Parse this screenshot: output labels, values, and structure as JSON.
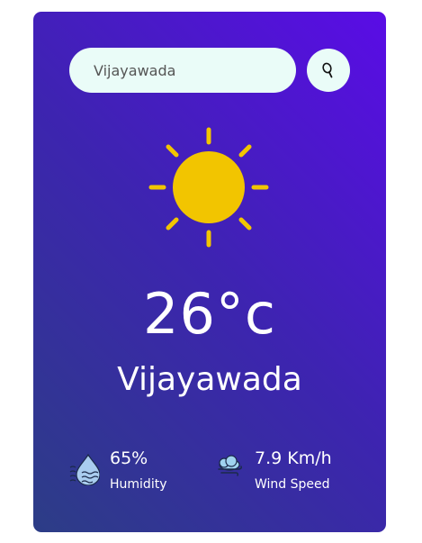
{
  "search": {
    "value": "Vijayawada",
    "icon": "search-icon"
  },
  "weather": {
    "icon": "sun-icon",
    "temperature": "26°c",
    "city": "Vijayawada"
  },
  "humidity": {
    "icon": "humidity-icon",
    "value": "65%",
    "label": "Humidity"
  },
  "wind": {
    "icon": "wind-icon",
    "value": "7.9 Km/h",
    "label": "Wind Speed"
  },
  "colors": {
    "gradient_top_right": "#5a0ce6",
    "gradient_bottom_left": "#2c3d86",
    "input_background": "#eafcf8",
    "sun": "#f2c500",
    "text": "#ffffff"
  }
}
